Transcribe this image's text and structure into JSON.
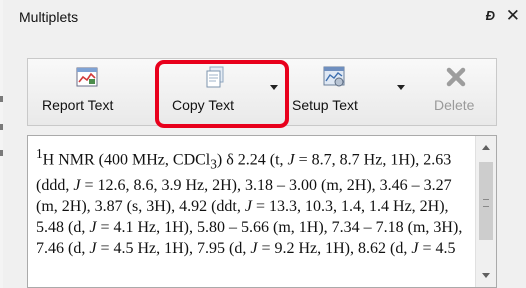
{
  "panel": {
    "title": "Multiplets",
    "float_icon": "restore-icon",
    "close_icon": "close-icon"
  },
  "toolbar": {
    "report_text": {
      "label": "Report Text",
      "icon": "report-icon"
    },
    "copy_text": {
      "label": "Copy Text",
      "icon": "copy-icon",
      "highlighted": true,
      "highlight_color": "#e8001c"
    },
    "setup_text": {
      "label": "Setup Text",
      "icon": "setup-icon"
    },
    "delete": {
      "label": "Delete",
      "icon": "delete-icon",
      "enabled": false
    }
  },
  "report": {
    "sup1": "1",
    "p1": "H NMR (400 MHz, CDCl",
    "sub3": "3",
    "p2": ") δ 2.24 (t, ",
    "J": "J",
    "p3": " = 8.7, 8.7 Hz, 1H), 2.63 (ddd, ",
    "p4": " = 12.6, 8.6, 3.9 Hz, 2H), 3.18 – 3.00 (m, 2H), 3.46 – 3.27 (m, 2H), 3.87 (s, 3H), 4.92 (ddt, ",
    "p5": " = 13.3, 10.3, 1.4, 1.4 Hz, 2H), 5.48 (d, ",
    "p6": " = 4.1 Hz, 1H), 5.80 – 5.66 (m, 1H), 7.34 – 7.18 (m, 3H), 7.46 (d, ",
    "p7": " = 4.5 Hz, 1H), 7.95 (d, ",
    "p8": " = 9.2 Hz, 1H), 8.62 (d, ",
    "p9": " = 4.5"
  }
}
